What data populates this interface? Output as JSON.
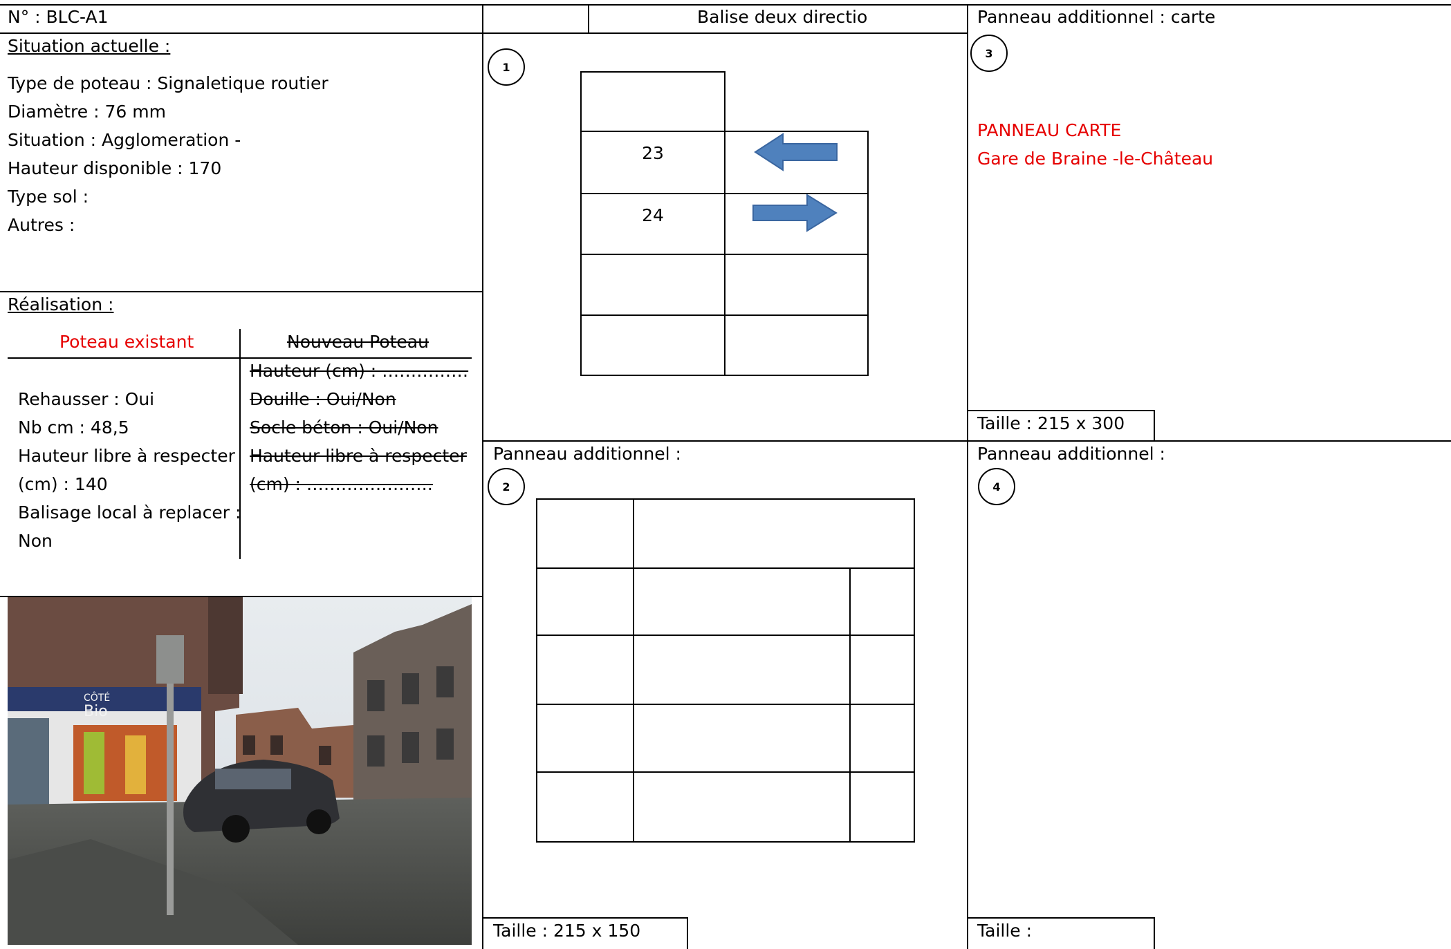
{
  "header": {
    "id_label": "N° : BLC-A1",
    "panel1_title": "Balise deux directio",
    "panel3_title": "Panneau additionnel : carte"
  },
  "situation": {
    "heading": "Situation actuelle :",
    "lines": [
      "Type de poteau : Signaletique routier",
      "Diamètre : 76 mm",
      "Situation : Agglomeration -",
      "Hauteur disponible : 170",
      "Type sol :",
      "Autres :"
    ]
  },
  "realisation": {
    "heading": "Réalisation :",
    "col_left_title": "Poteau existant",
    "col_right_title": "Nouveau Poteau",
    "left_lines": [
      "Rehausser : Oui",
      "Nb cm : 48,5",
      "Hauteur libre à respecter",
      "(cm) : 140",
      "Balisage local à replacer :",
      "Non"
    ],
    "right_lines": [
      "Hauteur (cm) : ……………",
      "Douille : Oui/Non",
      "Socle béton : Oui/Non",
      "Hauteur libre à respecter",
      "(cm) : …………………."
    ]
  },
  "panel1": {
    "number": "1",
    "rows": [
      {
        "value": "",
        "arrow": ""
      },
      {
        "value": "23",
        "arrow": "left-arrow"
      },
      {
        "value": "24",
        "arrow": "right-arrow"
      },
      {
        "value": "",
        "arrow": ""
      },
      {
        "value": "",
        "arrow": ""
      }
    ],
    "arrow_color": "#4f81bd"
  },
  "panel2": {
    "label": "Panneau additionnel :",
    "number": "2",
    "size": "Taille : 215 x 150"
  },
  "panel3": {
    "number": "3",
    "line1": "PANNEAU CARTE",
    "line2": "Gare de Braine -le-Château",
    "size": "Taille : 215 x 300"
  },
  "panel4": {
    "label": "Panneau additionnel :",
    "number": "4",
    "size": "Taille :"
  },
  "photo": {
    "sign_left": "CÔTÉ",
    "sign_right": "Bio"
  },
  "colors": {
    "red": "#e60000",
    "arrow": "#4f81bd"
  }
}
